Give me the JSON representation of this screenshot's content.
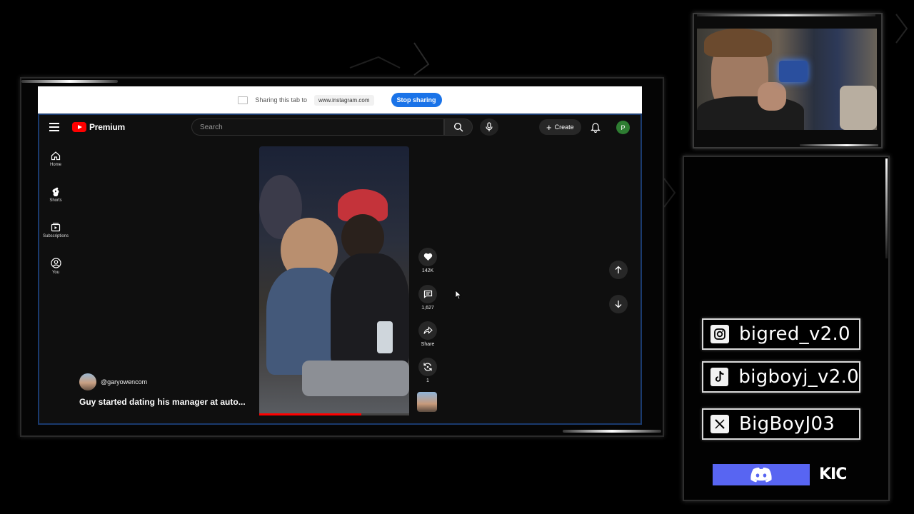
{
  "browser_share": {
    "message": "Sharing this tab to",
    "url": "www.instagram.com",
    "stop_label": "Stop sharing"
  },
  "youtube": {
    "logo_text": "Premium",
    "search_placeholder": "Search",
    "create_label": "Create",
    "avatar_letter": "P",
    "sidebar": [
      {
        "label": "Home",
        "icon": "home-icon"
      },
      {
        "label": "Shorts",
        "icon": "shorts-icon"
      },
      {
        "label": "Subscriptions",
        "icon": "subscriptions-icon"
      },
      {
        "label": "You",
        "icon": "account-icon"
      }
    ],
    "short": {
      "channel": "@garyowencom",
      "title": "Guy started dating his manager at auto...",
      "progress": 0.68,
      "likes": "142K",
      "comments": "1,627",
      "share_label": "Share",
      "remix_count": "1"
    }
  },
  "overlay": {
    "instagram": "bigred_v2.0",
    "tiktok": "bigboyj_v2.0",
    "x": "BigBoyJ03",
    "kick": "KIC"
  },
  "colors": {
    "youtube_red": "#ff0000",
    "share_blue": "#1a73e8",
    "discord": "#5865f2",
    "avatar_green": "#2e7d32"
  }
}
